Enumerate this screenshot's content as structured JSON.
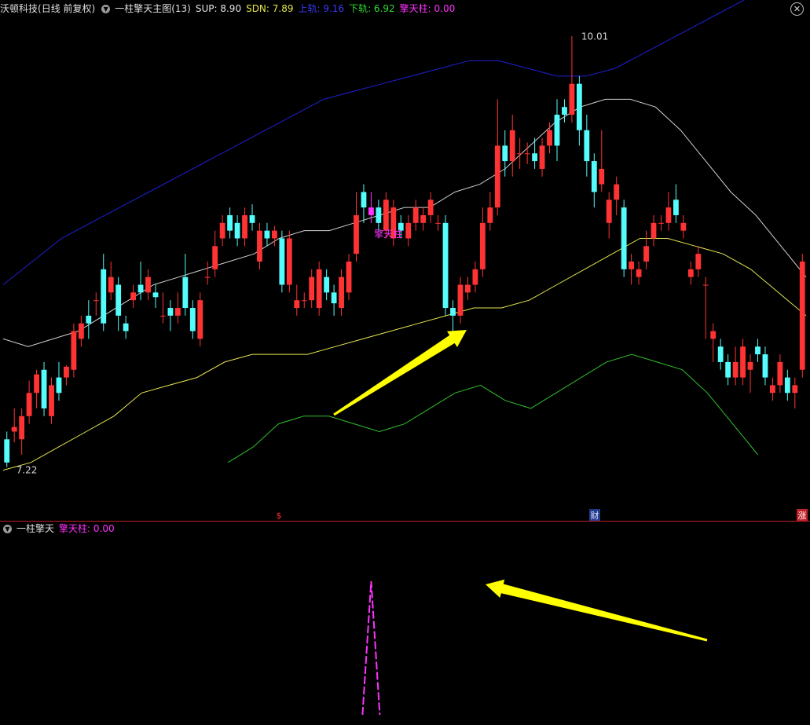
{
  "header": {
    "stock_name": "沃顿科技",
    "period": "(日线 前复权)",
    "indicator_name": "一柱擎天主图",
    "indicator_param": "(13)",
    "sup_label": "SUP: 8.90",
    "sdn_label": "SDN: 7.89",
    "upper_label": "上轨: 9.16",
    "lower_label": "下轨: 6.92",
    "qtz_label": "擎天柱: 0.00"
  },
  "sub_header": {
    "indicator_name": "一柱擎天",
    "qtz_label": "擎天柱: 0.00"
  },
  "icons": {
    "dropdown": "chevron-down-icon",
    "close": "close-icon"
  },
  "colors": {
    "up": "#ff3333",
    "down": "#54fcfc",
    "signal": "#ff33ff",
    "upper_band": "#1f1fd6",
    "sup_line": "#cfcfcf",
    "sdn_line": "#e6e64d",
    "lower_band": "#2fbf2f",
    "arrow": "#ffff00",
    "divider": "#c0202a"
  },
  "chart_data": [
    {
      "type": "candlestick",
      "title": "沃顿科技 一柱擎天主图",
      "ylim": [
        7.0,
        10.1
      ],
      "high_label": "10.01",
      "low_label": "7.22",
      "signal_label": "擎天柱",
      "markers": [
        "$",
        "财",
        "涨"
      ],
      "candles": [
        [
          7.4,
          7.25,
          7.45,
          7.22
        ],
        [
          7.45,
          7.48,
          7.6,
          7.38
        ],
        [
          7.4,
          7.55,
          7.6,
          7.3
        ],
        [
          7.55,
          7.7,
          7.78,
          7.5
        ],
        [
          7.7,
          7.82,
          7.85,
          7.6
        ],
        [
          7.85,
          7.6,
          7.9,
          7.55
        ],
        [
          7.55,
          7.75,
          7.8,
          7.5
        ],
        [
          7.8,
          7.7,
          7.9,
          7.65
        ],
        [
          7.8,
          7.87,
          7.88,
          7.75
        ],
        [
          7.85,
          8.1,
          8.15,
          7.8
        ],
        [
          8.05,
          8.15,
          8.2,
          8.0
        ],
        [
          8.2,
          8.15,
          8.3,
          8.05
        ],
        [
          8.3,
          8.3,
          8.35,
          8.2
        ],
        [
          8.5,
          8.15,
          8.6,
          8.1
        ],
        [
          8.35,
          8.45,
          8.55,
          8.3
        ],
        [
          8.4,
          8.2,
          8.45,
          8.1
        ],
        [
          8.15,
          8.1,
          8.2,
          8.05
        ],
        [
          8.3,
          8.35,
          8.4,
          8.25
        ],
        [
          8.4,
          8.35,
          8.55,
          8.3
        ],
        [
          8.35,
          8.45,
          8.5,
          8.3
        ],
        [
          8.35,
          8.32,
          8.4,
          8.25
        ],
        [
          8.2,
          8.2,
          8.35,
          8.15
        ],
        [
          8.25,
          8.2,
          8.3,
          8.1
        ],
        [
          8.2,
          8.25,
          8.35,
          8.15
        ],
        [
          8.45,
          8.25,
          8.6,
          8.2
        ],
        [
          8.25,
          8.1,
          8.3,
          8.05
        ],
        [
          8.05,
          8.3,
          8.35,
          8.0
        ],
        [
          8.45,
          8.45,
          8.55,
          8.4
        ],
        [
          8.5,
          8.65,
          8.75,
          8.45
        ],
        [
          8.7,
          8.8,
          8.85,
          8.65
        ],
        [
          8.85,
          8.75,
          8.9,
          8.7
        ],
        [
          8.8,
          8.7,
          8.85,
          8.65
        ],
        [
          8.7,
          8.85,
          8.9,
          8.65
        ],
        [
          8.85,
          8.8,
          8.92,
          8.75
        ],
        [
          8.55,
          8.75,
          8.8,
          8.5
        ],
        [
          8.75,
          8.7,
          8.8,
          8.65
        ],
        [
          8.7,
          8.75,
          8.78,
          8.65
        ],
        [
          8.7,
          8.4,
          8.75,
          8.35
        ],
        [
          8.4,
          8.7,
          8.75,
          8.35
        ],
        [
          8.25,
          8.3,
          8.4,
          8.2
        ],
        [
          8.3,
          8.3,
          8.35,
          8.25
        ],
        [
          8.3,
          8.45,
          8.5,
          8.25
        ],
        [
          8.25,
          8.5,
          8.55,
          8.2
        ],
        [
          8.45,
          8.35,
          8.5,
          8.3
        ],
        [
          8.35,
          8.28,
          8.4,
          8.2
        ],
        [
          8.25,
          8.45,
          8.5,
          8.2
        ],
        [
          8.35,
          8.55,
          8.6,
          8.3
        ],
        [
          8.6,
          8.85,
          9.0,
          8.55
        ],
        [
          9.0,
          8.9,
          9.05,
          8.8
        ],
        [
          8.9,
          8.85,
          9.0,
          8.8
        ],
        [
          8.9,
          8.8,
          8.95,
          8.75
        ],
        [
          8.75,
          8.95,
          9.0,
          8.7
        ],
        [
          8.7,
          8.9,
          8.95,
          8.65
        ],
        [
          8.8,
          8.75,
          8.85,
          8.7
        ],
        [
          8.7,
          8.8,
          8.85,
          8.65
        ],
        [
          8.8,
          8.9,
          8.95,
          8.75
        ],
        [
          8.8,
          8.85,
          8.9,
          8.75
        ],
        [
          8.85,
          8.95,
          9.0,
          8.8
        ],
        [
          8.8,
          8.8,
          8.85,
          8.75
        ],
        [
          8.8,
          8.25,
          8.85,
          8.2
        ],
        [
          8.25,
          8.2,
          8.3,
          8.1
        ],
        [
          8.2,
          8.4,
          8.45,
          8.15
        ],
        [
          8.35,
          8.4,
          8.45,
          8.3
        ],
        [
          8.4,
          8.5,
          8.55,
          8.35
        ],
        [
          8.5,
          8.8,
          8.9,
          8.45
        ],
        [
          8.8,
          8.9,
          9.0,
          8.75
        ],
        [
          8.9,
          9.3,
          9.6,
          8.85
        ],
        [
          9.3,
          9.2,
          9.4,
          9.1
        ],
        [
          9.2,
          9.4,
          9.5,
          9.1
        ],
        [
          9.25,
          9.25,
          9.35,
          9.15
        ],
        [
          9.25,
          9.25,
          9.32,
          9.18
        ],
        [
          9.25,
          9.2,
          9.35,
          9.15
        ],
        [
          9.15,
          9.3,
          9.35,
          9.1
        ],
        [
          9.3,
          9.4,
          9.45,
          9.25
        ],
        [
          9.5,
          9.3,
          9.6,
          9.2
        ],
        [
          9.55,
          9.5,
          9.6,
          9.45
        ],
        [
          9.5,
          9.7,
          10.01,
          9.45
        ],
        [
          9.7,
          9.4,
          9.75,
          9.3
        ],
        [
          9.4,
          9.2,
          9.5,
          9.1
        ],
        [
          9.2,
          9.0,
          9.25,
          8.9
        ],
        [
          9.05,
          9.15,
          9.4,
          9.0
        ],
        [
          8.8,
          8.95,
          9.0,
          8.7
        ],
        [
          8.95,
          9.05,
          9.1,
          8.85
        ],
        [
          8.9,
          8.5,
          8.95,
          8.45
        ],
        [
          8.5,
          8.55,
          8.6,
          8.4
        ],
        [
          8.45,
          8.5,
          8.55,
          8.4
        ],
        [
          8.55,
          8.65,
          8.75,
          8.5
        ],
        [
          8.7,
          8.8,
          8.85,
          8.65
        ],
        [
          8.8,
          8.8,
          8.85,
          8.75
        ],
        [
          8.8,
          8.9,
          9.0,
          8.75
        ],
        [
          8.95,
          8.85,
          9.05,
          8.8
        ],
        [
          8.75,
          8.8,
          8.85,
          8.7
        ],
        [
          8.45,
          8.5,
          8.55,
          8.4
        ],
        [
          8.5,
          8.6,
          8.65,
          8.45
        ],
        [
          8.4,
          8.4,
          8.45,
          8.05
        ],
        [
          8.05,
          8.1,
          8.15,
          7.9
        ],
        [
          8.0,
          7.9,
          8.05,
          7.85
        ],
        [
          7.9,
          7.8,
          7.95,
          7.75
        ],
        [
          7.8,
          7.9,
          8.0,
          7.75
        ],
        [
          7.8,
          8.0,
          8.05,
          7.75
        ],
        [
          7.85,
          7.9,
          7.95,
          7.7
        ],
        [
          8.0,
          7.95,
          8.05,
          7.9
        ],
        [
          7.95,
          7.8,
          8.0,
          7.75
        ],
        [
          7.7,
          7.75,
          7.8,
          7.65
        ],
        [
          7.75,
          7.9,
          7.95,
          7.7
        ],
        [
          7.8,
          7.7,
          7.85,
          7.65
        ],
        [
          7.7,
          7.75,
          7.8,
          7.6
        ],
        [
          7.85,
          8.55,
          8.6,
          7.8
        ]
      ],
      "signal_bar_index": 49,
      "series": [
        {
          "name": "上轨",
          "values": [
            8.4,
            8.55,
            8.7,
            8.8,
            8.9,
            9.0,
            9.1,
            9.2,
            9.3,
            9.4,
            9.5,
            9.6,
            9.65,
            9.7,
            9.75,
            9.8,
            9.85,
            9.85,
            9.8,
            9.75,
            9.75,
            9.8,
            9.9,
            10.0,
            10.1,
            10.2,
            10.3,
            10.4
          ]
        },
        {
          "name": "SUP",
          "values": [
            8.05,
            8.0,
            8.05,
            8.1,
            8.2,
            8.3,
            8.4,
            8.45,
            8.5,
            8.55,
            8.6,
            8.7,
            8.75,
            8.75,
            8.8,
            8.85,
            8.9,
            8.9,
            9.0,
            9.05,
            9.15,
            9.3,
            9.45,
            9.55,
            9.6,
            9.6,
            9.55,
            9.4,
            9.2,
            9.0,
            8.85,
            8.65,
            8.45
          ]
        },
        {
          "name": "SDN",
          "values": [
            7.2,
            7.25,
            7.35,
            7.45,
            7.55,
            7.7,
            7.75,
            7.8,
            7.9,
            7.95,
            7.95,
            7.95,
            8.0,
            8.05,
            8.1,
            8.15,
            8.2,
            8.25,
            8.25,
            8.3,
            8.4,
            8.5,
            8.6,
            8.7,
            8.7,
            8.65,
            8.6,
            8.5,
            8.35,
            8.2
          ]
        },
        {
          "name": "下轨",
          "values": [
            7.25,
            7.35,
            7.5,
            7.55,
            7.55,
            7.5,
            7.45,
            7.5,
            7.6,
            7.7,
            7.75,
            7.65,
            7.6,
            7.7,
            7.8,
            7.9,
            7.95,
            7.9,
            7.85,
            7.7,
            7.5,
            7.3
          ]
        }
      ]
    },
    {
      "type": "line",
      "title": "一柱擎天",
      "series": [
        {
          "name": "擎天柱",
          "values": [
            0,
            1,
            0
          ]
        }
      ],
      "ylim": [
        0,
        1
      ]
    }
  ]
}
